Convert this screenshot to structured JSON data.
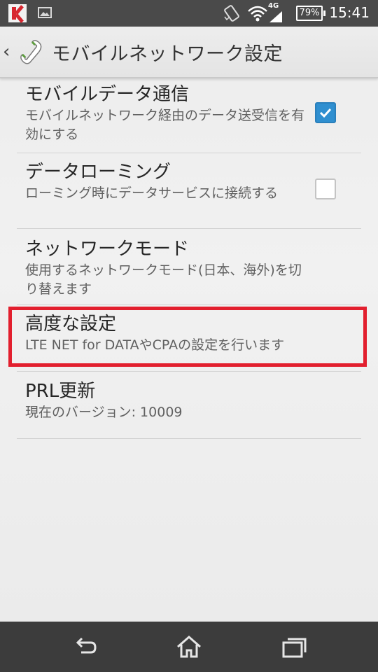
{
  "status_bar": {
    "network_type": "4G",
    "battery_percent": "79%",
    "clock": "15:41",
    "icons": [
      "kaspersky-icon",
      "image-icon",
      "rotate-icon",
      "wifi-icon",
      "signal-icon",
      "battery-icon"
    ]
  },
  "action_bar": {
    "back_glyph": "‹",
    "title": "モバイルネットワーク設定",
    "icon": "phone-handset-icon"
  },
  "preferences": [
    {
      "title": "モバイルデータ通信",
      "summary": "モバイルネットワーク経由のデータ送受信を有効にする",
      "checkbox": true
    },
    {
      "title": "データローミング",
      "summary": "ローミング時にデータサービスに接続する",
      "checkbox": false
    },
    {
      "title": "ネットワークモード",
      "summary": "使用するネットワークモード(日本、海外)を切り替えます"
    },
    {
      "title": "高度な設定",
      "summary": "LTE NET for DATAやCPAの設定を行います",
      "highlighted": true
    },
    {
      "title": "PRL更新",
      "summary": "現在のバージョン: 10009"
    }
  ],
  "colors": {
    "checkbox_checked": "#2f8fd0",
    "highlight": "#e21f2e",
    "status_bar": "#4a4a4a",
    "nav_bar": "#3c3c3c"
  },
  "nav_bar": {
    "buttons": [
      "back-icon",
      "home-icon",
      "recent-apps-icon"
    ]
  }
}
